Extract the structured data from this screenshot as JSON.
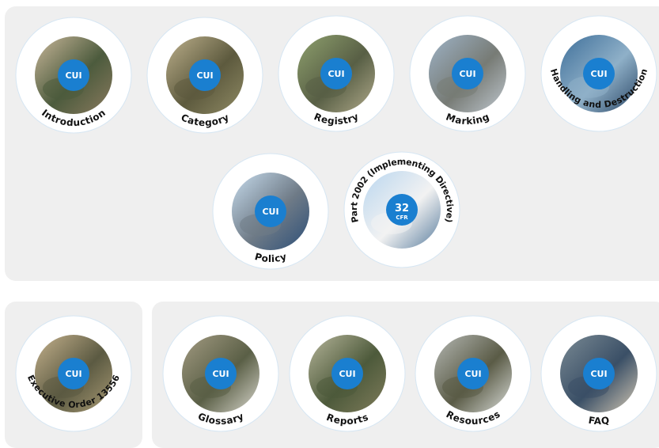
{
  "colors": {
    "badge": "#1a7fd0",
    "ring": "#ffffff",
    "panel": "#efefef",
    "text": "#111111"
  },
  "tiles": [
    {
      "id": "introduction",
      "label": "Introduction",
      "badge": "CUI",
      "photo_theme": "soldier-at-laptop"
    },
    {
      "id": "category",
      "label": "Category",
      "badge": "CUI",
      "photo_theme": "sniper-with-rifle"
    },
    {
      "id": "registry",
      "label": "Registry",
      "badge": "CUI",
      "photo_theme": "armored-vehicle"
    },
    {
      "id": "marking",
      "label": "Marking",
      "badge": "CUI",
      "photo_theme": "aircraft-engine"
    },
    {
      "id": "handling",
      "label": "Handling and Destruction",
      "badge": "CUI",
      "photo_theme": "jet-engine-technician"
    },
    {
      "id": "policy",
      "label": "Policy",
      "badge": "CUI",
      "photo_theme": "aircraft-carrier"
    },
    {
      "id": "cfr",
      "label": "Part 2002 (Implementing Directive)",
      "badge": "32",
      "badge_sub": "CFR",
      "photo_theme": "jet-formation"
    },
    {
      "id": "eo",
      "label": "Executive Order 13556",
      "badge": "CUI",
      "photo_theme": "troops-marching"
    },
    {
      "id": "glossary",
      "label": "Glossary",
      "badge": "CUI",
      "photo_theme": "soldiers-reading"
    },
    {
      "id": "reports",
      "label": "Reports",
      "badge": "CUI",
      "photo_theme": "soldier-in-field"
    },
    {
      "id": "resources",
      "label": "Resources",
      "badge": "CUI",
      "photo_theme": "soldier-with-missile"
    },
    {
      "id": "faq",
      "label": "FAQ",
      "badge": "CUI",
      "photo_theme": "airman-at-monitors"
    }
  ]
}
